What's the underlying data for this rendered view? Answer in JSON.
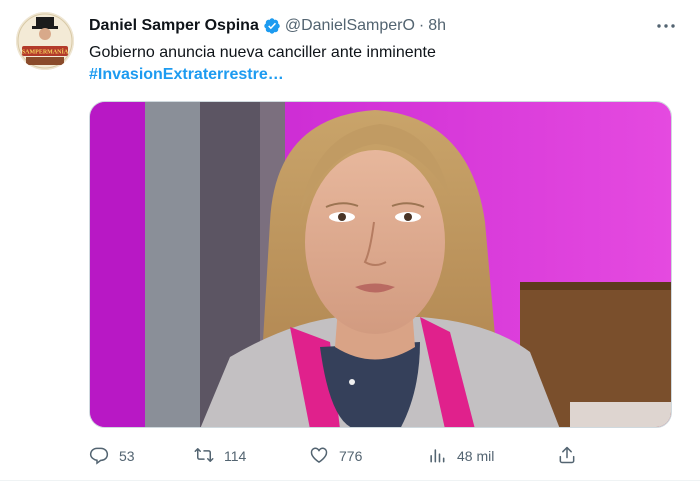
{
  "tweet": {
    "author_name": "Daniel Samper Ospina",
    "handle": "@DanielSamperO",
    "separator": "·",
    "time": "8h",
    "text": "Gobierno anuncia nueva canciller ante inminente",
    "hashtag": "#InvasionExtraterrestre…",
    "avatar_caption": "SAMPERMANÍA"
  },
  "actions": {
    "replies": "53",
    "retweets": "114",
    "likes": "776",
    "views": "48 mil"
  },
  "icons": {
    "verified": "verified-badge-icon",
    "more": "more-icon",
    "reply": "reply-icon",
    "retweet": "retweet-icon",
    "like": "heart-icon",
    "views": "views-icon",
    "share": "share-icon"
  },
  "colors": {
    "accent": "#1d9bf0",
    "muted": "#536471",
    "background_magenta": "#d42ad8"
  }
}
